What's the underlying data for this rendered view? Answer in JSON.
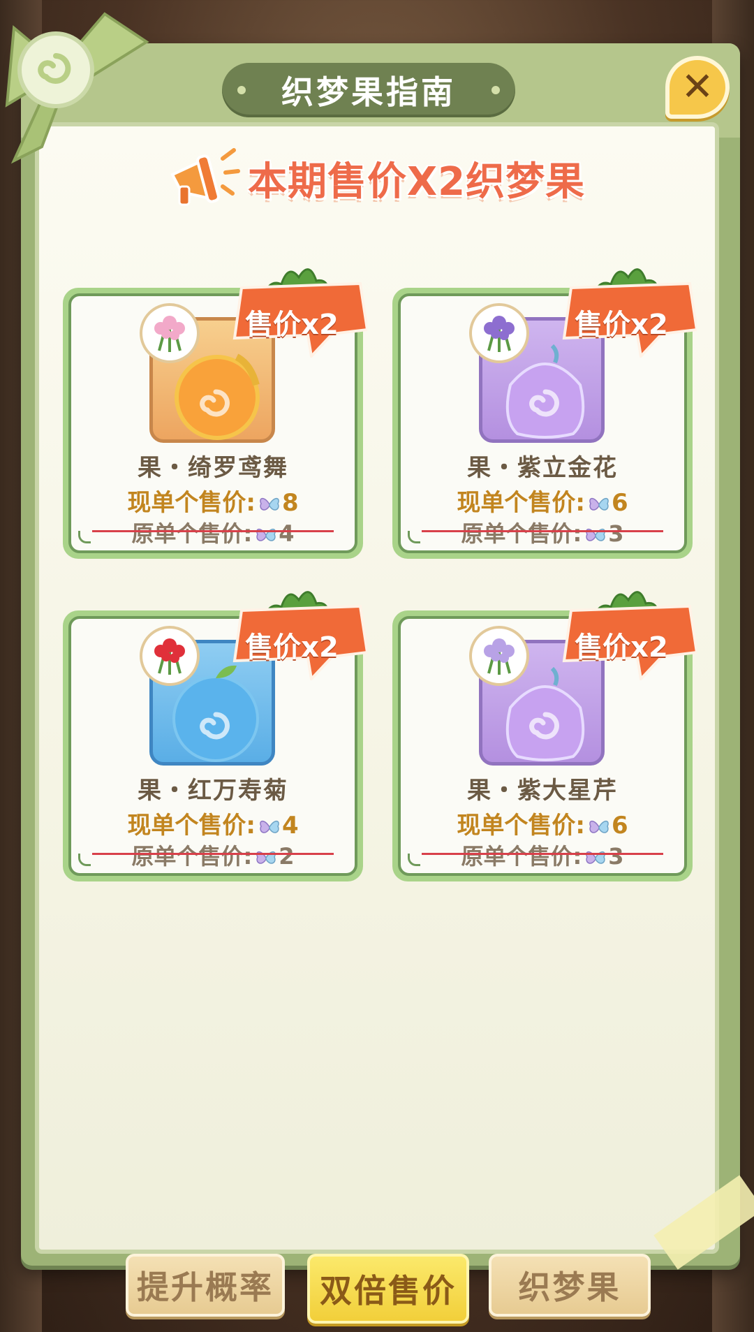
{
  "title": "织梦果指南",
  "banner": "本期售价X2织梦果",
  "badge_label": "售价x2",
  "close_icon": "close-icon",
  "cards": [
    {
      "name": "果・绮罗鸢舞",
      "now_label": "现单个售价:",
      "now_value": "8",
      "old_label": "原单个售价:",
      "old_value": "4",
      "color": "orange",
      "fruit_color": "#f9a23a",
      "flower": "pink-lily-flower"
    },
    {
      "name": "果・紫立金花",
      "now_label": "现单个售价:",
      "now_value": "6",
      "old_label": "原单个售价:",
      "old_value": "3",
      "color": "purple",
      "fruit_color": "#c7a2f0",
      "flower": "purple-lupine-flower"
    },
    {
      "name": "果・红万寿菊",
      "now_label": "现单个售价:",
      "now_value": "4",
      "old_label": "原单个售价:",
      "old_value": "2",
      "color": "blue",
      "fruit_color": "#5ab3ec",
      "flower": "red-marigold-flower"
    },
    {
      "name": "果・紫大星芹",
      "now_label": "现单个售价:",
      "now_value": "6",
      "old_label": "原单个售价:",
      "old_value": "3",
      "color": "purple",
      "fruit_color": "#c7a2f0",
      "flower": "purple-astrantia-flower"
    }
  ],
  "tabs": [
    {
      "label": "提升概率",
      "active": false
    },
    {
      "label": "双倍售价",
      "active": true
    },
    {
      "label": "织梦果",
      "active": false
    }
  ],
  "colors": {
    "accent": "#ee6b4a",
    "panel_green": "#9db376",
    "price_gold": "#c2851f",
    "strike_red": "#d8404a"
  }
}
